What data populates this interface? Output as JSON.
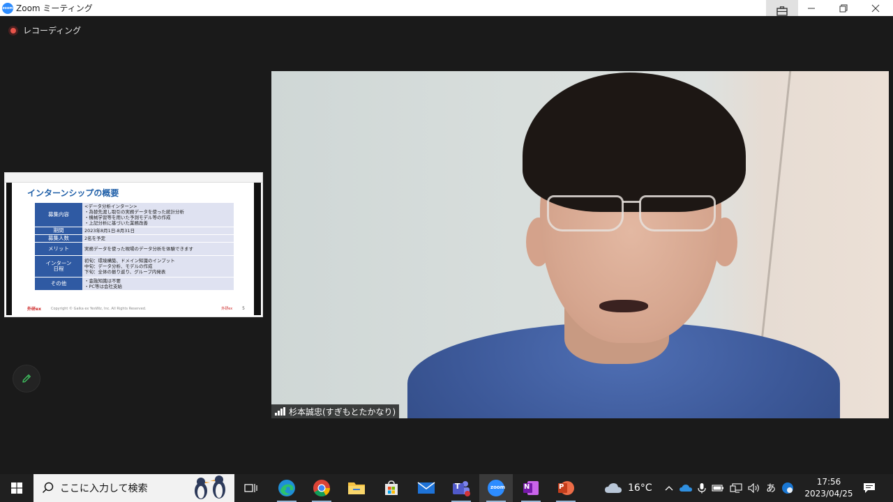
{
  "window": {
    "title": "Zoom ミーティング",
    "app_icon_text": "zoom"
  },
  "meeting": {
    "recording_label": "レコーディング",
    "participant_name": "杉本誠忠(すぎもとたかなり)"
  },
  "shared_slide": {
    "title": "インターンシップの概要",
    "rows": [
      {
        "label": "募集内容",
        "value_lines": [
          "<データ分析インターン>",
          "・為替先渡し取引の実務データを使った統計分析",
          "・機械学習等を用いた予測モデル等の作成",
          "・上記分析に基づいた業務改善"
        ]
      },
      {
        "label": "期間",
        "value_lines": [
          "2023年8月1日-8月31日"
        ]
      },
      {
        "label": "募集人数",
        "value_lines": [
          "2名を予定"
        ]
      },
      {
        "label": "メリット",
        "value_lines": [
          "実務データを使った現場のデータ分析を体験できます"
        ]
      },
      {
        "label_lines": [
          "インターン",
          "日程"
        ],
        "value_lines": [
          "初旬：環境構築、ドメイン知識のインプット",
          "中旬：データ分析、モデルの作成",
          "下旬：全体の振り返り、グループ内発表"
        ]
      },
      {
        "label": "その他",
        "value_lines": [
          "・金融知識は不要",
          "・PC等は会社支給"
        ]
      }
    ],
    "footer_brand": "外研ex",
    "footer_copyright": "Copyright © Gaika ex YesWiz, Inc. All Rights Reserved.",
    "footer_logo": "外研ex",
    "page_number": "5"
  },
  "taskbar": {
    "search_placeholder": "ここに入力して検索",
    "weather_temp": "16°C",
    "ime_label": "あ",
    "time": "17:56",
    "date": "2023/04/25",
    "zoom_icon_text": "zoom",
    "teams_icon_text": "T",
    "onenote_icon_text": "N",
    "powerpoint_icon_text": "P"
  },
  "colors": {
    "zoom_blue": "#2d8cff",
    "recording_red": "#e8544a",
    "slide_header_blue": "#2f5aa3",
    "slide_cell_bg": "#dfe2f1",
    "annotate_green": "#3fbf5f"
  }
}
